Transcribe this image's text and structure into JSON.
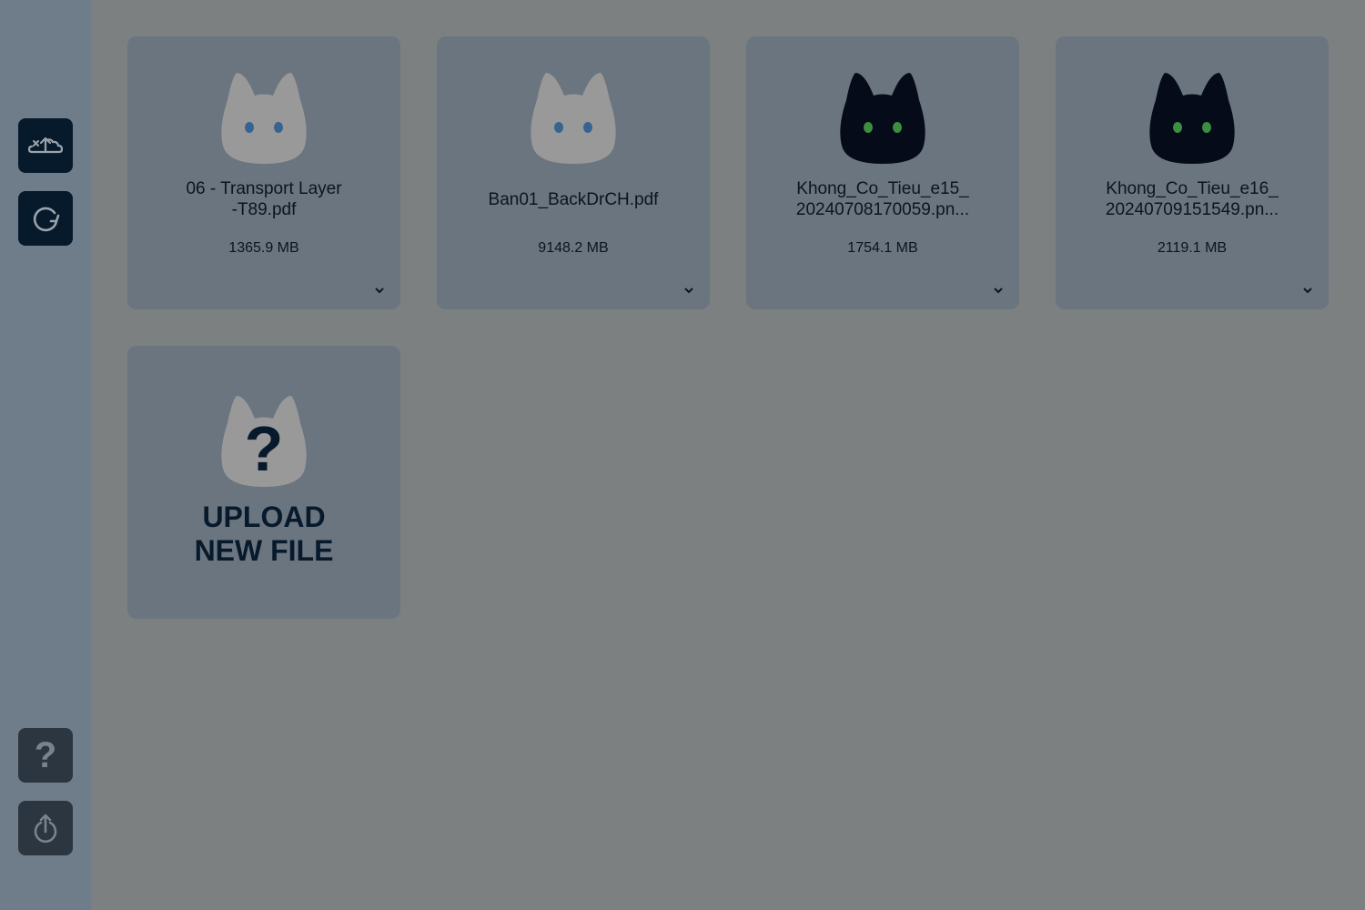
{
  "sidebar": {
    "top_buttons": [
      {
        "icon": "cloud-upload-icon"
      },
      {
        "icon": "refresh-icon"
      }
    ],
    "bottom_buttons": [
      {
        "icon": "help-icon",
        "glyph": "?"
      },
      {
        "icon": "logout-icon"
      }
    ]
  },
  "files": [
    {
      "name": "06 - Transport Layer\n-T89.pdf",
      "size": "1365.9 MB",
      "icon": "cat-outline-icon"
    },
    {
      "name": "Ban01_BackDrCH.pdf",
      "size": "9148.2 MB",
      "icon": "cat-outline-icon"
    },
    {
      "name": "Khong_Co_Tieu_e15_\n20240708170059.pn...",
      "size": "1754.1 MB",
      "icon": "cat-dark-icon"
    },
    {
      "name": "Khong_Co_Tieu_e16_\n20240709151549.pn...",
      "size": "2119.1 MB",
      "icon": "cat-dark-icon"
    }
  ],
  "upload": {
    "label": "UPLOAD\nNEW FILE",
    "glyph": "?"
  },
  "colors": {
    "overlay_bg": "#7c8080",
    "sidebar_bg": "#6f7d8b",
    "card_bg": "#6b7580",
    "button_dark": "#071a2c",
    "cat_light": "#999999",
    "cat_dark": "#050b18",
    "eye_blue": "#36638f",
    "eye_green": "#3e8e41"
  }
}
